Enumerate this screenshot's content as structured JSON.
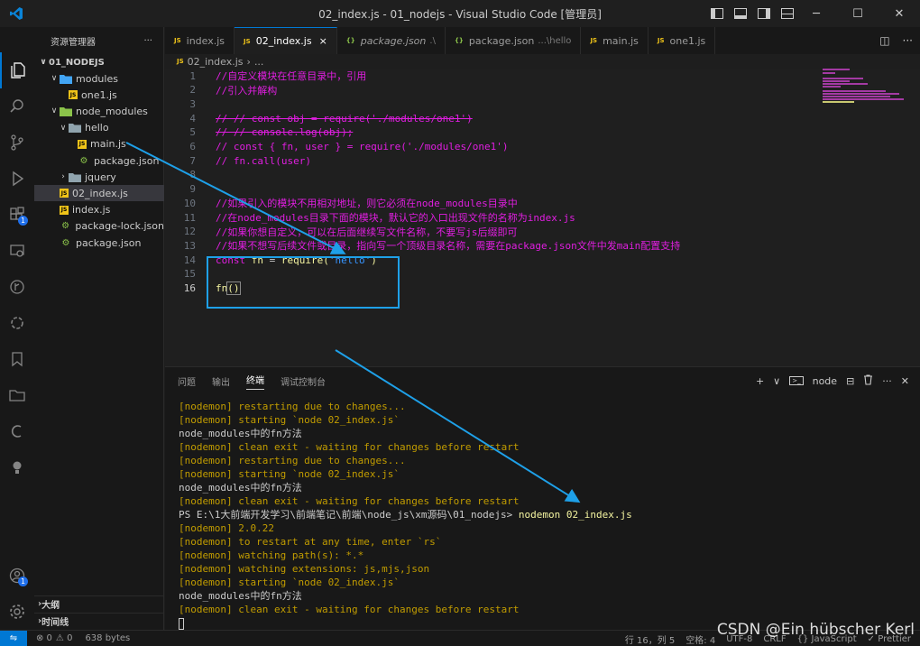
{
  "window": {
    "title": "02_index.js - 01_nodejs - Visual Studio Code [管理员]",
    "controls": [
      "─",
      "☐",
      "✕"
    ]
  },
  "sidebar": {
    "header": "资源管理器",
    "more": "···",
    "root": "01_NODEJS",
    "items": [
      {
        "label": "modules",
        "type": "folder",
        "depth": 1,
        "open": true
      },
      {
        "label": "one1.js",
        "type": "js",
        "depth": 2
      },
      {
        "label": "node_modules",
        "type": "folder",
        "depth": 1,
        "open": true
      },
      {
        "label": "hello",
        "type": "folder",
        "depth": 2,
        "open": true
      },
      {
        "label": "main.js",
        "type": "js",
        "depth": 3
      },
      {
        "label": "package.json",
        "type": "json",
        "depth": 3
      },
      {
        "label": "jquery",
        "type": "folder",
        "depth": 2,
        "open": false
      },
      {
        "label": "02_index.js",
        "type": "js",
        "depth": 1,
        "selected": true
      },
      {
        "label": "index.js",
        "type": "js",
        "depth": 1
      },
      {
        "label": "package-lock.json",
        "type": "json",
        "depth": 1
      },
      {
        "label": "package.json",
        "type": "json",
        "depth": 1
      }
    ],
    "outline": "大纲",
    "timeline": "时间线"
  },
  "tabs": [
    {
      "label": "index.js",
      "icon": "JS",
      "active": false
    },
    {
      "label": "02_index.js",
      "icon": "JS",
      "active": true,
      "close": "×"
    },
    {
      "label": "package.json",
      "icon": "{}",
      "active": false,
      "extra": ".\\"
    },
    {
      "label": "package.json",
      "icon": "{}",
      "active": false,
      "extra": "...\\hello"
    },
    {
      "label": "main.js",
      "icon": "JS",
      "active": false
    },
    {
      "label": "one1.js",
      "icon": "JS",
      "active": false
    }
  ],
  "breadcrumb": {
    "icon": "JS",
    "file": "02_index.js",
    "sep": "›",
    "more": "..."
  },
  "editor": {
    "current_line": 16,
    "lines": [
      {
        "n": "1",
        "text": "//自定义模块在任意目录中，引用",
        "style": "c-cmt"
      },
      {
        "n": "2",
        "text": "//引入并解构",
        "style": "c-cmt"
      },
      {
        "n": "3",
        "text": "",
        "style": "c-cmt"
      },
      {
        "n": "4",
        "text": "// // const obj = require('./modules/one1')",
        "style": "c-strike"
      },
      {
        "n": "5",
        "text": "// // console.log(obj);",
        "style": "c-strike"
      },
      {
        "n": "6",
        "text": "// const { fn, user } = require('./modules/one1')",
        "style": "c-cmt"
      },
      {
        "n": "7",
        "text": "// fn.call(user)",
        "style": "c-cmt"
      },
      {
        "n": "8",
        "text": "",
        "style": "c-cmt"
      },
      {
        "n": "9",
        "text": "",
        "style": "c-cmt"
      },
      {
        "n": "10",
        "text": "//如果引入的模块不用相对地址，则它必须在node_modules目录中",
        "style": "c-cmt"
      },
      {
        "n": "11",
        "text": "//在node_modules目录下面的模块，默认它的入口出现文件的名称为index.js",
        "style": "c-cmt"
      },
      {
        "n": "12",
        "text": "//如果你想自定义，可以在后面继续写文件名称，不要写js后缀即可",
        "style": "c-cmt"
      },
      {
        "n": "13",
        "text": "//如果不想写后续文件或目录，指向写一个顶级目录名称，需要在package.json文件中发main配置支持",
        "style": "c-cmt"
      },
      {
        "n": "14",
        "text": "",
        "style": "code14"
      },
      {
        "n": "15",
        "text": "",
        "style": "c-cmt"
      },
      {
        "n": "16",
        "text": "",
        "style": "code16"
      }
    ],
    "line14": {
      "kw": "const",
      "var": "fn",
      "eq": "=",
      "fn": "require",
      "open": "(",
      "str": "'hello'",
      "close": ")"
    },
    "line16": {
      "fn": "fn",
      "parens": "()"
    }
  },
  "panel": {
    "tabs": [
      "问题",
      "输出",
      "终端",
      "调试控制台"
    ],
    "active_tab": "终端",
    "actions": {
      "add": "+",
      "dropdown": "∨",
      "terminal_name": "node",
      "split": "⊟",
      "trash": "🗑",
      "more": "···",
      "close": "✕"
    },
    "terminal_lines": [
      {
        "text": "[nodemon] restarting due to changes...",
        "style": "t-yellow"
      },
      {
        "text": "[nodemon] starting `node 02_index.js`",
        "style": "t-yellow"
      },
      {
        "text": "node_modules中的fn方法",
        "style": "t-normal"
      },
      {
        "text": "[nodemon] clean exit - waiting for changes before restart",
        "style": "t-yellow"
      },
      {
        "text": "[nodemon] restarting due to changes...",
        "style": "t-yellow"
      },
      {
        "text": "[nodemon] starting `node 02_index.js`",
        "style": "t-yellow"
      },
      {
        "text": "node_modules中的fn方法",
        "style": "t-normal"
      },
      {
        "text": "[nodemon] clean exit - waiting for changes before restart",
        "style": "t-yellow"
      },
      {
        "text": "PS E:\\1大前端开发学习\\前端笔记\\前端\\node_js\\xm源码\\01_nodejs> ",
        "style": "t-normal",
        "cmd": "nodemon 02_index.js"
      },
      {
        "text": "[nodemon] 2.0.22",
        "style": "t-yellow"
      },
      {
        "text": "[nodemon] to restart at any time, enter `rs`",
        "style": "t-yellow"
      },
      {
        "text": "[nodemon] watching path(s): *.*",
        "style": "t-yellow"
      },
      {
        "text": "[nodemon] watching extensions: js,mjs,json",
        "style": "t-yellow"
      },
      {
        "text": "[nodemon] starting `node 02_index.js`",
        "style": "t-yellow"
      },
      {
        "text": "node_modules中的fn方法",
        "style": "t-normal"
      },
      {
        "text": "[nodemon] clean exit - waiting for changes before restart",
        "style": "t-yellow"
      }
    ]
  },
  "statusbar": {
    "remote": "⇋",
    "errors": "⊗ 0",
    "warnings": "⚠ 0",
    "size": "638 bytes",
    "position": "行 16，列 5",
    "spaces": "空格: 4",
    "encoding": "UTF-8",
    "eol": "CRLF",
    "language": "{} JavaScript",
    "prettier": "✓ Prettier"
  },
  "watermark": "CSDN @Ein hübscher Kerl",
  "colors": {
    "accent": "#0078d4",
    "annotation": "#1ea0e8",
    "comment": "#e01ee0",
    "nodemon": "#c19c00"
  }
}
